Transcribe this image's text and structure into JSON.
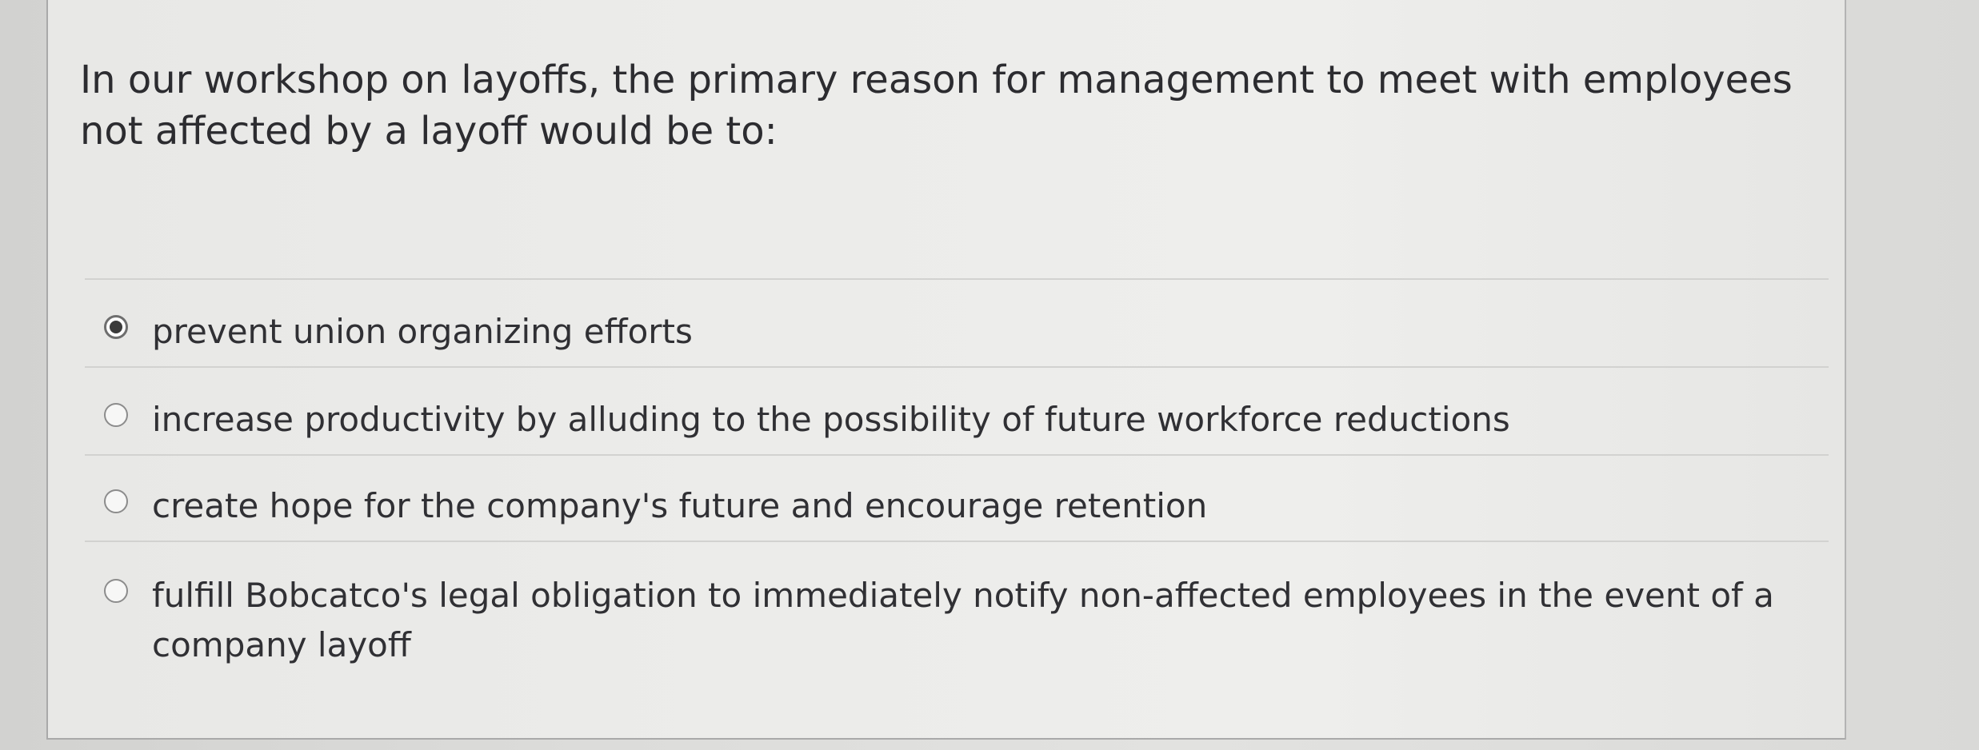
{
  "question": {
    "text": "In our workshop on layoffs, the primary reason for management to meet with employees not affected by a layoff would be to:"
  },
  "options": [
    {
      "label": "prevent union organizing efforts",
      "selected": true
    },
    {
      "label": "increase productivity by alluding to the possibility of future workforce reductions",
      "selected": false
    },
    {
      "label": "create hope for the company's future and encourage retention",
      "selected": false
    },
    {
      "label": "fulfill Bobcatco's legal obligation to immediately notify non-affected employees in the event of a company layoff",
      "selected": false
    }
  ]
}
